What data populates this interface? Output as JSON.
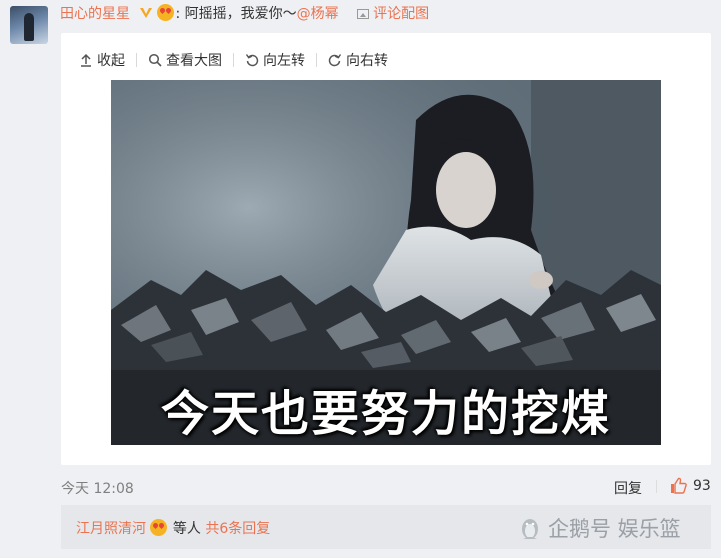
{
  "comment": {
    "author": "田心的星星",
    "separator": ":",
    "text": "阿摇摇，我爱你～",
    "mention": "@杨幂",
    "image_link": "评论配图"
  },
  "toolbar": {
    "collapse": "收起",
    "view_large": "查看大图",
    "rotate_left": "向左转",
    "rotate_right": "向右转"
  },
  "image": {
    "caption": "今天也要努力的挖煤"
  },
  "meta": {
    "time": "今天 12:08",
    "reply": "回复",
    "like_count": "93"
  },
  "replies": {
    "user": "江月照清河",
    "and_others": "等人",
    "total": "共6条回复"
  },
  "watermark": "企鹅号 娱乐篮",
  "colors": {
    "link": "#eb7350",
    "badge": "#f5a623",
    "like": "#eb7350"
  }
}
